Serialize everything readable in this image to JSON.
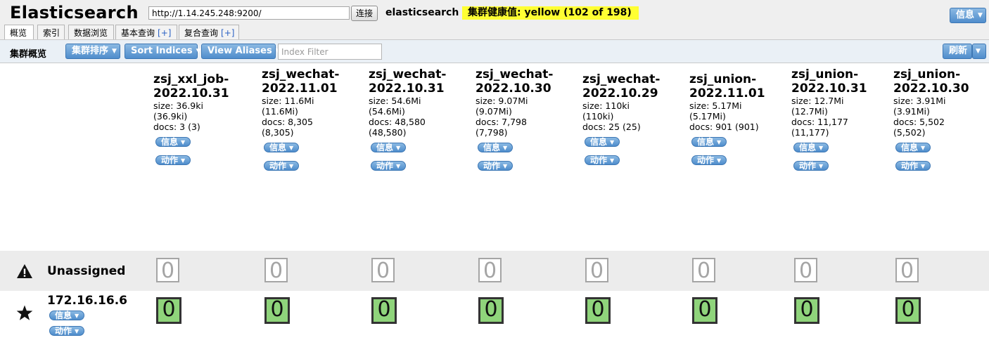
{
  "header": {
    "app_title": "Elasticsearch",
    "url_value": "http://1.14.245.248:9200/",
    "connect_label": "连接",
    "cluster_name": "elasticsearch",
    "health_text": "集群健康值: yellow (102 of 198)",
    "info_label": "信息"
  },
  "tabs": [
    {
      "label": "概览"
    },
    {
      "label": "索引"
    },
    {
      "label": "数据浏览"
    },
    {
      "label": "基本查询",
      "plus": "[+]"
    },
    {
      "label": "复合查询",
      "plus": "[+]"
    }
  ],
  "toolbar": {
    "title": "集群概览",
    "sort_label": "集群排序",
    "sort_indices_label": "Sort Indices",
    "view_aliases_label": "View Aliases",
    "filter_placeholder": "Index Filter",
    "refresh_label": "刷新"
  },
  "index_buttons": {
    "info": "信息",
    "action": "动作"
  },
  "indices": [
    {
      "name1": "zsj_xxl_job-",
      "name2": "2022.10.31",
      "size": "size: 36.9ki",
      "size_total": "(36.9ki)",
      "docs": "docs: 3 (3)",
      "docs_total": ""
    },
    {
      "name1": "zsj_wechat-",
      "name2": "2022.11.01",
      "size": "size: 11.6Mi",
      "size_total": "(11.6Mi)",
      "docs": "docs: 8,305",
      "docs_total": "(8,305)"
    },
    {
      "name1": "zsj_wechat-",
      "name2": "2022.10.31",
      "size": "size: 54.6Mi",
      "size_total": "(54.6Mi)",
      "docs": "docs: 48,580",
      "docs_total": "(48,580)"
    },
    {
      "name1": "zsj_wechat-",
      "name2": "2022.10.30",
      "size": "size: 9.07Mi",
      "size_total": "(9.07Mi)",
      "docs": "docs: 7,798",
      "docs_total": "(7,798)"
    },
    {
      "name1": "zsj_wechat-",
      "name2": "2022.10.29",
      "size": "size: 110ki",
      "size_total": "(110ki)",
      "docs": "docs: 25 (25)",
      "docs_total": ""
    },
    {
      "name1": "zsj_union-",
      "name2": "2022.11.01",
      "size": "size: 5.17Mi",
      "size_total": "(5.17Mi)",
      "docs": "docs: 901 (901)",
      "docs_total": ""
    },
    {
      "name1": "zsj_union-",
      "name2": "2022.10.31",
      "size": "size: 12.7Mi",
      "size_total": "(12.7Mi)",
      "docs": "docs: 11,177",
      "docs_total": "(11,177)"
    },
    {
      "name1": "zsj_union-",
      "name2": "2022.10.30",
      "size": "size: 3.91Mi",
      "size_total": "(3.91Mi)",
      "docs": "docs: 5,502",
      "docs_total": "(5,502)"
    }
  ],
  "unassigned": {
    "label": "Unassigned",
    "icon": "warning-icon",
    "shards": [
      "0",
      "0",
      "0",
      "0",
      "0",
      "0",
      "0",
      "0"
    ]
  },
  "node": {
    "ip": "172.16.16.6",
    "icon": "star-icon",
    "info_label": "信息",
    "action_label": "动作",
    "shards": [
      "0",
      "0",
      "0",
      "0",
      "0",
      "0",
      "0",
      "0"
    ]
  }
}
